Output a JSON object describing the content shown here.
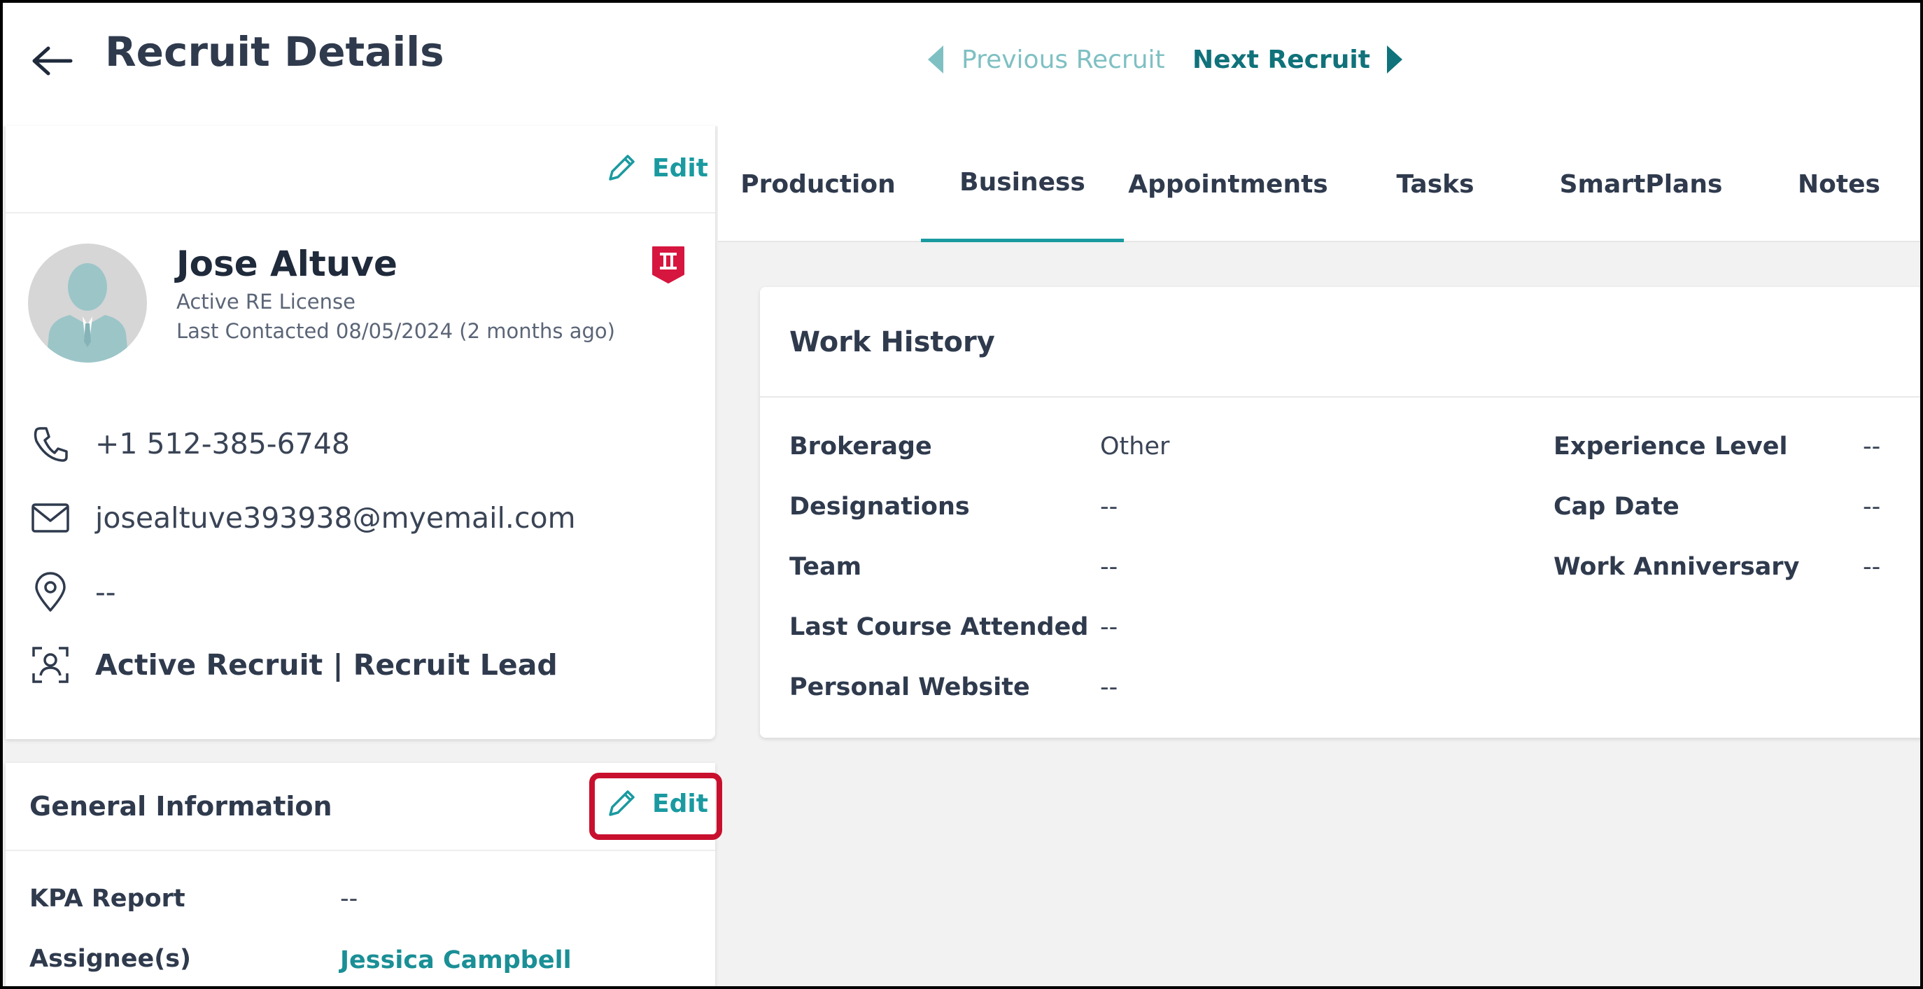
{
  "header": {
    "title": "Recruit Details",
    "prev_label": "Previous Recruit",
    "next_label": "Next Recruit"
  },
  "profile": {
    "edit_label": "Edit",
    "name": "Jose Altuve",
    "license": "Active RE License",
    "last_contacted": "Last Contacted 08/05/2024 (2 months ago)",
    "phone": "+1 512-385-6748",
    "email": "josealtuve393938@myemail.com",
    "location": "--",
    "status": "Active Recruit | Recruit Lead"
  },
  "general": {
    "title": "General Information",
    "edit_label": "Edit",
    "rows": [
      {
        "label": "KPA Report",
        "value": "--"
      },
      {
        "label": "Assignee(s)",
        "value": "Jessica Campbell"
      }
    ]
  },
  "tabs": [
    {
      "label": "Production",
      "active": false
    },
    {
      "label": "Business",
      "active": true
    },
    {
      "label": "Appointments",
      "active": false
    },
    {
      "label": "Tasks",
      "active": false
    },
    {
      "label": "SmartPlans",
      "active": false
    },
    {
      "label": "Notes",
      "active": false
    }
  ],
  "work_history": {
    "title": "Work History",
    "left_fields": [
      {
        "label": "Brokerage",
        "value": "Other"
      },
      {
        "label": "Designations",
        "value": "--"
      },
      {
        "label": "Team",
        "value": "--"
      },
      {
        "label": "Last Course Attended",
        "value": "--"
      },
      {
        "label": "Personal Website",
        "value": "--"
      }
    ],
    "right_fields": [
      {
        "label": "Experience Level",
        "value": "--"
      },
      {
        "label": "Cap Date",
        "value": "--"
      },
      {
        "label": "Work Anniversary",
        "value": "--"
      }
    ]
  },
  "colors": {
    "accent": "#1a9aa0",
    "accent_dark": "#10727a",
    "accent_light": "#7fc0c3",
    "highlight": "#c8102e",
    "badge": "#d6163f"
  }
}
